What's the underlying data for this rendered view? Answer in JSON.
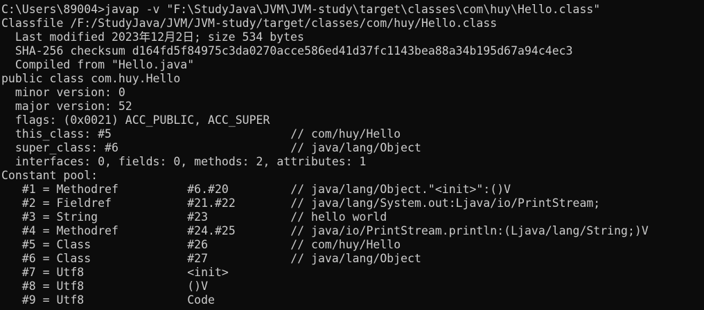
{
  "terminal": {
    "lines": [
      "C:\\Users\\89004>javap -v \"F:\\StudyJava\\JVM\\JVM-study\\target\\classes\\com\\huy\\Hello.class\"",
      "Classfile /F:/StudyJava/JVM/JVM-study/target/classes/com/huy/Hello.class",
      "  Last modified 2023年12月2日; size 534 bytes",
      "  SHA-256 checksum d164fd5f84975c3da0270acce586ed41d37fc1143bea88a34b195d67a94c4ec3",
      "  Compiled from \"Hello.java\"",
      "public class com.huy.Hello",
      "  minor version: 0",
      "  major version: 52",
      "  flags: (0x0021) ACC_PUBLIC, ACC_SUPER",
      "  this_class: #5                          // com/huy/Hello",
      "  super_class: #6                         // java/lang/Object",
      "  interfaces: 0, fields: 0, methods: 2, attributes: 1",
      "Constant pool:",
      "   #1 = Methodref          #6.#20         // java/lang/Object.\"<init>\":()V",
      "   #2 = Fieldref           #21.#22        // java/lang/System.out:Ljava/io/PrintStream;",
      "   #3 = String             #23            // hello world",
      "   #4 = Methodref          #24.#25        // java/io/PrintStream.println:(Ljava/lang/String;)V",
      "   #5 = Class              #26            // com/huy/Hello",
      "   #6 = Class              #27            // java/lang/Object",
      "   #7 = Utf8               <init>",
      "   #8 = Utf8               ()V",
      "   #9 = Utf8               Code"
    ]
  }
}
